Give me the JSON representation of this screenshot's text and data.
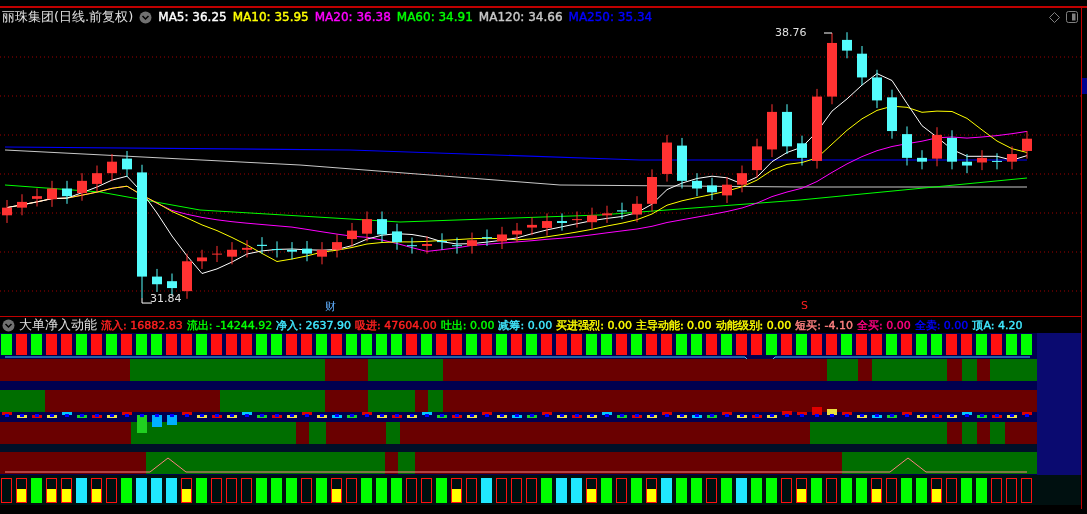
{
  "chart": {
    "title": "丽珠集团(日线.前复权)",
    "ma": [
      {
        "label": "MA5: 36.25",
        "color": "#ffffff"
      },
      {
        "label": "MA10: 35.95",
        "color": "#ffff00"
      },
      {
        "label": "MA20: 36.38",
        "color": "#ff00ff"
      },
      {
        "label": "MA60: 34.91",
        "color": "#00ff00"
      },
      {
        "label": "MA120: 34.66",
        "color": "#c8c8c8"
      },
      {
        "label": "MA250: 35.34",
        "color": "#0000ff"
      }
    ],
    "high_label": "38.76",
    "low_label": "31.84",
    "event_marker": "财",
    "signal_marker": "S"
  },
  "indicator": {
    "title": "大单净入动能",
    "items": [
      {
        "label": "流入: 16882.83",
        "color": "#ff2020"
      },
      {
        "label": "流出: -14244.92",
        "color": "#00ff00"
      },
      {
        "label": "净入: 2637.90",
        "color": "#40e8ff"
      },
      {
        "label": "吸进: 47604.00",
        "color": "#ff2020"
      },
      {
        "label": "吐出: 0.00",
        "color": "#00ff00"
      },
      {
        "label": "减筹: 0.00",
        "color": "#40e8ff"
      },
      {
        "label": "买进强烈: 0.00",
        "color": "#ffff00"
      },
      {
        "label": "主导动能: 0.00",
        "color": "#ffff00"
      },
      {
        "label": "动能级别: 0.00",
        "color": "#ffff00"
      },
      {
        "label": "短买: -4.10",
        "color": "#ff8080"
      },
      {
        "label": "全买: 0.00",
        "color": "#ff0080"
      },
      {
        "label": "全卖: 0.00",
        "color": "#0000ff"
      },
      {
        "label": "顶A: 4.20",
        "color": "#40e8ff"
      }
    ]
  }
}
